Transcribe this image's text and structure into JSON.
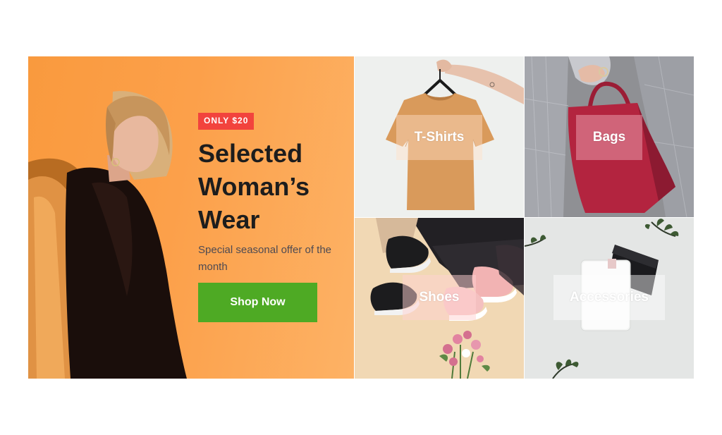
{
  "hero": {
    "badge": "ONLY $20",
    "title": "Selected Woman’s Wear",
    "subtitle": "Special seasonal offer of the month",
    "button_label": "Shop Now"
  },
  "categories": [
    {
      "label": "T-Shirts"
    },
    {
      "label": "Bags"
    },
    {
      "label": "Shoes"
    },
    {
      "label": "Accessories"
    }
  ],
  "colors": {
    "badge": "#f2433d",
    "button": "#4eaa24",
    "hero_bg": "#fca04a",
    "title_text": "#1d1d1d"
  }
}
